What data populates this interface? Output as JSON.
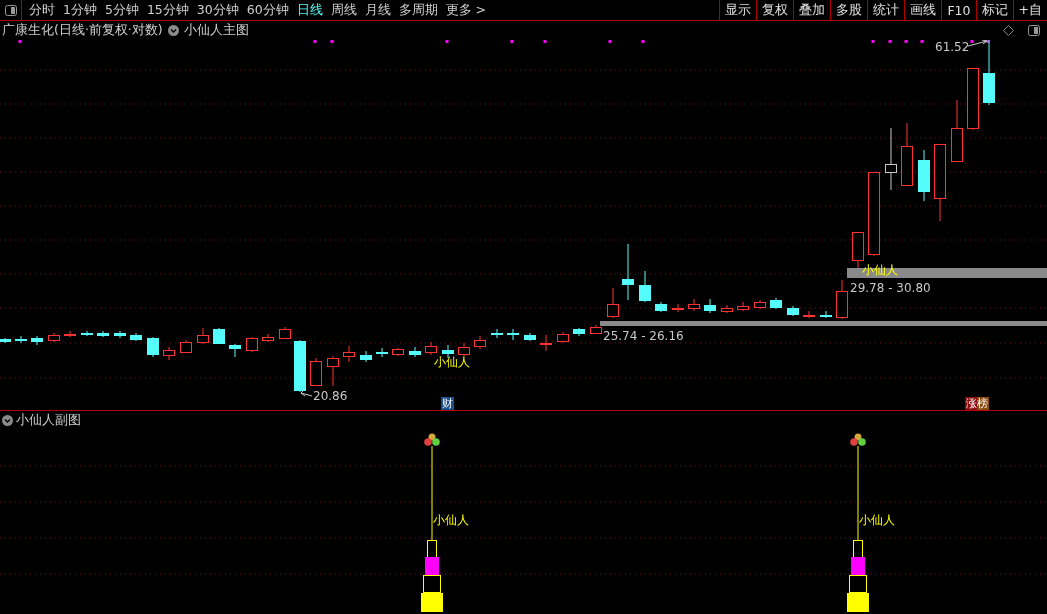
{
  "toolbar": {
    "periods": [
      {
        "label": "分时",
        "selected": false
      },
      {
        "label": "1分钟",
        "selected": false
      },
      {
        "label": "5分钟",
        "selected": false
      },
      {
        "label": "15分钟",
        "selected": false
      },
      {
        "label": "30分钟",
        "selected": false
      },
      {
        "label": "60分钟",
        "selected": false
      },
      {
        "label": "日线",
        "selected": true
      },
      {
        "label": "周线",
        "selected": false
      },
      {
        "label": "月线",
        "selected": false
      },
      {
        "label": "多周期",
        "selected": false
      },
      {
        "label": "更多 >",
        "selected": false
      }
    ],
    "actions": [
      "显示",
      "复权",
      "叠加",
      "多股",
      "统计",
      "画线",
      "F10",
      "标记",
      "+自"
    ]
  },
  "main_chart": {
    "title": "广康生化(日线·前复权·对数)",
    "indicator": "小仙人主图",
    "high_price": "61.52",
    "zones": [
      "29.78 - 30.80",
      "25.74 - 26.16"
    ],
    "signal_labels": [
      "小仙人",
      "小仙人"
    ],
    "low_price": "20.86",
    "badges": [
      {
        "text": "财",
        "kind": "finance"
      },
      {
        "text": "涨榜",
        "kind": "gainers"
      }
    ]
  },
  "sub_chart": {
    "indicator": "小仙人副图",
    "signal_labels": [
      "小仙人",
      "小仙人"
    ]
  }
}
